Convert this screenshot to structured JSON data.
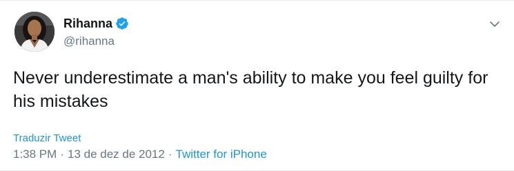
{
  "tweet": {
    "author": {
      "display_name": "Rihanna",
      "handle": "@rihanna",
      "verified": true,
      "avatar_icon": "profile-photo"
    },
    "text": "Never underestimate a man's ability to make you feel guilty for his mistakes",
    "translate_label": "Traduzir Tweet",
    "time": "1:38 PM",
    "separator": "·",
    "date": "13 de dez de 2012",
    "source": "Twitter for iPhone"
  },
  "colors": {
    "accent": "#1b95e0",
    "verified_badge": "#1da1f2",
    "secondary_text": "#657786",
    "primary_text": "#14171a"
  },
  "icons": {
    "verified": "verified-badge-icon",
    "menu": "chevron-down-icon"
  }
}
